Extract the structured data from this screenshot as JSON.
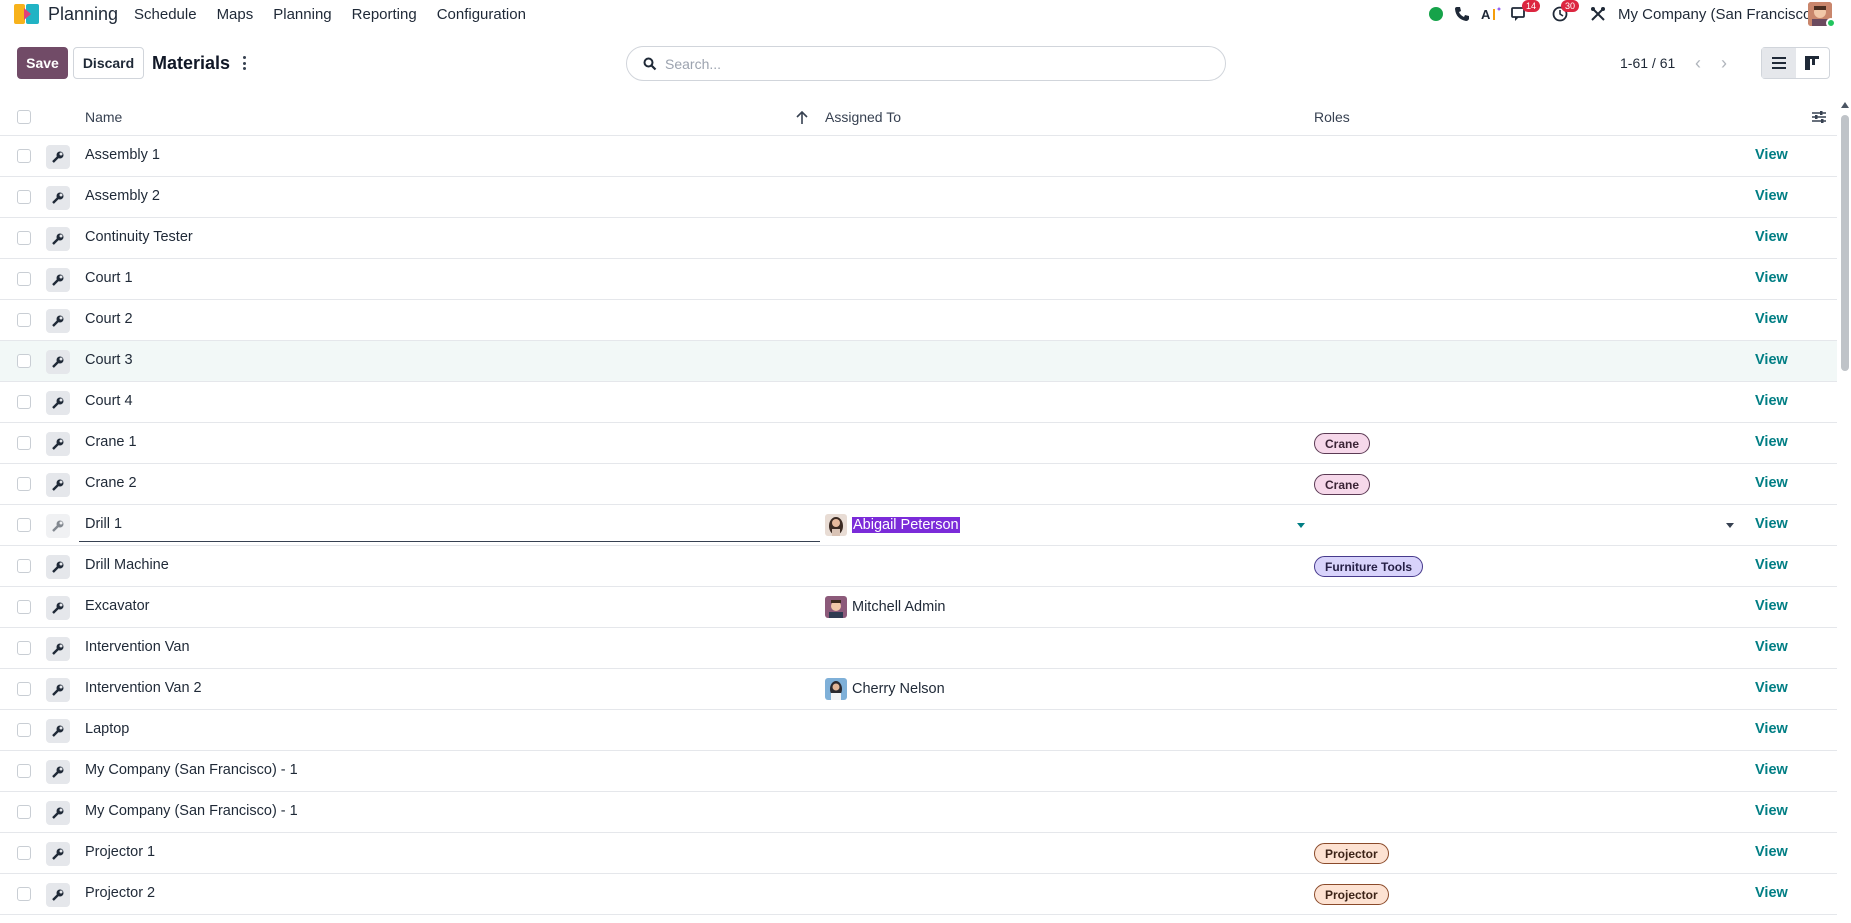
{
  "navbar": {
    "app_name": "Planning",
    "menu": [
      "Schedule",
      "Maps",
      "Planning",
      "Reporting",
      "Configuration"
    ],
    "messages_count": "14",
    "activities_count": "30",
    "company": "My Company (San Francisco)"
  },
  "control": {
    "save_label": "Save",
    "discard_label": "Discard",
    "title": "Materials",
    "search_placeholder": "Search...",
    "pager": "1-61 / 61"
  },
  "table": {
    "headers": {
      "name": "Name",
      "assigned": "Assigned To",
      "roles": "Roles"
    },
    "view_label": "View",
    "rows": [
      {
        "name": "Assembly 1"
      },
      {
        "name": "Assembly 2"
      },
      {
        "name": "Continuity Tester"
      },
      {
        "name": "Court 1"
      },
      {
        "name": "Court 2"
      },
      {
        "name": "Court 3"
      },
      {
        "name": "Court 4"
      },
      {
        "name": "Crane 1",
        "role": "Crane"
      },
      {
        "name": "Crane 2",
        "role": "Crane"
      },
      {
        "name": "Drill 1",
        "assigned": "Abigail Peterson"
      },
      {
        "name": "Drill Machine",
        "role": "Furniture Tools"
      },
      {
        "name": "Excavator",
        "assigned": "Mitchell Admin"
      },
      {
        "name": "Intervention Van"
      },
      {
        "name": "Intervention Van 2",
        "assigned": "Cherry Nelson"
      },
      {
        "name": "Laptop"
      },
      {
        "name": "My Company (San Francisco) - 1"
      },
      {
        "name": "My Company (San Francisco) - 1"
      },
      {
        "name": "Projector 1",
        "role": "Projector"
      },
      {
        "name": "Projector 2",
        "role": "Projector"
      }
    ]
  },
  "colors": {
    "primary": "#714b67",
    "link": "#017e84",
    "badge": "#dc2640",
    "selection": "#7b2bd9"
  },
  "icons": [
    "planning-app-icon",
    "status-online-icon",
    "phone-icon",
    "ai-icon",
    "messages-icon",
    "clock-icon",
    "tools-icon",
    "search-icon",
    "list-view-icon",
    "kanban-view-icon",
    "wrench-icon",
    "sort-up-icon",
    "optional-columns-icon"
  ]
}
